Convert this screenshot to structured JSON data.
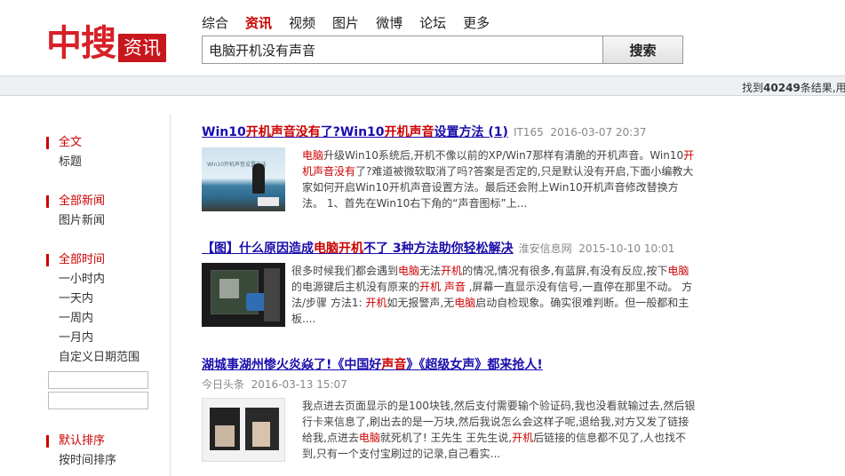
{
  "logo": {
    "main": "中搜",
    "badge": "资讯"
  },
  "nav": [
    {
      "label": "综合",
      "active": false
    },
    {
      "label": "资讯",
      "active": true
    },
    {
      "label": "视频",
      "active": false
    },
    {
      "label": "图片",
      "active": false
    },
    {
      "label": "微博",
      "active": false
    },
    {
      "label": "论坛",
      "active": false
    },
    {
      "label": "更多",
      "active": false
    }
  ],
  "search": {
    "value": "电脑开机没有声音",
    "button": "搜索"
  },
  "result_bar": {
    "prefix": "找到",
    "count": "40249",
    "suffix": "条结果,用时"
  },
  "sidebar": {
    "groups": [
      {
        "head": "全文",
        "items": [
          "标题"
        ]
      },
      {
        "head": "全部新闻",
        "items": [
          "图片新闻"
        ]
      },
      {
        "head": "全部时间",
        "items": [
          "一小时内",
          "一天内",
          "一周内",
          "一月内",
          "自定义日期范围"
        ]
      },
      {
        "head": "默认排序",
        "items": [
          "按时间排序"
        ]
      }
    ]
  },
  "results": [
    {
      "title_parts": [
        {
          "t": "Win10",
          "h": false
        },
        {
          "t": "开机声音没有",
          "h": true
        },
        {
          "t": "了?Win10",
          "h": false
        },
        {
          "t": "开机声音",
          "h": true
        },
        {
          "t": "设置方法 (1)",
          "h": false
        }
      ],
      "source": "IT165",
      "time": "2016-03-07 20:37",
      "thumb_caption": "Win10开机声音设置方法",
      "snippet_parts": [
        {
          "t": "电脑",
          "h": true
        },
        {
          "t": "升级Win10系统后,开机不像以前的XP/Win7那样有清脆的开机声音。Win10",
          "h": false
        },
        {
          "t": "开机声音没有",
          "h": true
        },
        {
          "t": "了?难道被微软取消了吗?答案是否定的,只是默认没有开启,下面小编教大家如何开启Win10开机声音设置方法。最后还会附上Win10开机声音修改替换方法。 1、首先在Win10右下角的“声音图标”上...",
          "h": false
        }
      ]
    },
    {
      "title_parts": [
        {
          "t": "【图】什么原因造成",
          "h": false
        },
        {
          "t": "电脑开机",
          "h": true
        },
        {
          "t": "不了 3种方法助你轻松解决",
          "h": false
        }
      ],
      "source": "淮安信息网",
      "time": "2015-10-10 10:01",
      "snippet_parts": [
        {
          "t": "很多时候我们都会遇到",
          "h": false
        },
        {
          "t": "电脑",
          "h": true
        },
        {
          "t": "无法",
          "h": false
        },
        {
          "t": "开机",
          "h": true
        },
        {
          "t": "的情况,情况有很多,有蓝屏,有没有反应,按下",
          "h": false
        },
        {
          "t": "电脑",
          "h": true
        },
        {
          "t": "的电源键后主机没有原来的",
          "h": false
        },
        {
          "t": "开机 声音",
          "h": true
        },
        {
          "t": " ,屏幕一直显示没有信号,一直停在那里不动。 方法/步骤 方法1: ",
          "h": false
        },
        {
          "t": "开机",
          "h": true
        },
        {
          "t": "如无报警声,无",
          "h": false
        },
        {
          "t": "电脑",
          "h": true
        },
        {
          "t": "启动自检现象。确实很难判断。但一般都和主板....",
          "h": false
        }
      ]
    },
    {
      "title_parts": [
        {
          "t": "湖城事湖州惨火炎焱了!《中国好",
          "h": false
        },
        {
          "t": "声音",
          "h": true
        },
        {
          "t": "》《超级女声》都来抢人!",
          "h": false
        }
      ],
      "source": "今日头条",
      "time": "2016-03-13 15:07",
      "snippet_parts": [
        {
          "t": "我点进去页面显示的是100块钱,然后支付需要输个验证码,我也没看就输过去,然后银行卡来信息了,刷出去的是一万块,然后我说怎么会这样子呢,退给我,对方又发了链接给我,点进去",
          "h": false
        },
        {
          "t": "电脑",
          "h": true
        },
        {
          "t": "就死机了! 王先生 王先生说,",
          "h": false
        },
        {
          "t": "开机",
          "h": true
        },
        {
          "t": "后链接的信息都不见了,人也找不到,只有一个支付宝刷过的记录,自己看实...",
          "h": false
        }
      ]
    }
  ],
  "colors": {
    "brand_red": "#c8161d",
    "link_blue": "#1a0dab",
    "highlight": "#cc0000"
  }
}
